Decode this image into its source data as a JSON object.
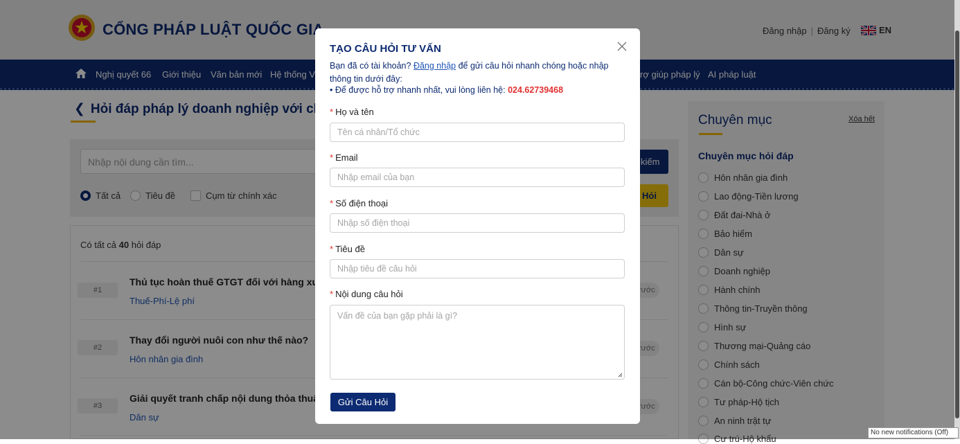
{
  "header": {
    "site_title": "CỔNG PHÁP LUẬT QUỐC GIA",
    "login": "Đăng nhập",
    "register": "Đăng ký",
    "lang": "EN"
  },
  "nav": {
    "items": [
      "Nghị quyết 66",
      "Giới thiệu",
      "Văn bản mới",
      "Hệ thống V",
      "rợ giúp pháp lý",
      "AI pháp luật"
    ]
  },
  "page": {
    "title": "Hỏi đáp pháp lý doanh nghiệp với chuy",
    "search_placeholder": "Nhập nội dung cần tìm...",
    "search_button": "kiếm",
    "ask_button": "Hỏi",
    "filters": [
      "Tất cả",
      "Tiêu đề",
      "Cụm từ chính xác"
    ],
    "count_prefix": "Có tất cả",
    "count_value": "40",
    "count_suffix": "hỏi đáp",
    "questions": [
      {
        "num": "#1",
        "title": "Thủ tục hoàn thuế GTGT đối với hàng xuấ",
        "category": "Thuế-Phí-Lệ phí",
        "badge": "rước"
      },
      {
        "num": "#2",
        "title": "Thay đổi người nuôi con như thế nào?",
        "category": "Hôn nhân gia đình",
        "badge": "rước"
      },
      {
        "num": "#3",
        "title": "Giải quyết tranh chấp nội dung thỏa thuậ",
        "category": "Dân sự",
        "badge": "rước"
      }
    ]
  },
  "sidebar": {
    "title": "Chuyên mục",
    "clear_all": "Xóa hết",
    "subtitle": "Chuyên mục hỏi đáp",
    "categories": [
      "Hôn nhân gia đình",
      "Lao động-Tiền lương",
      "Đất đai-Nhà ở",
      "Bảo hiểm",
      "Dân sự",
      "Doanh nghiệp",
      "Hành chính",
      "Thông tin-Truyền thông",
      "Hình sự",
      "Thương mại-Quảng cáo",
      "Chính sách",
      "Cán bộ-Công chức-Viên chức",
      "Tư pháp-Hộ tịch",
      "An ninh trật tự",
      "Cư trú-Hộ khẩu"
    ]
  },
  "modal": {
    "title": "TẠO CÂU HỎI TƯ VẤN",
    "intro_prefix": "Bạn đã có tài khoản?",
    "intro_link": "Đăng nhập",
    "intro_suffix": "để gửi câu hỏi nhanh chóng hoặc nhập thông tin dưới đây:",
    "hotline_text": "• Để được hỗ trợ nhanh nhất, vui lòng liên hệ:",
    "hotline_number": "024.62739468",
    "fields": {
      "name": {
        "label": "Họ và tên",
        "placeholder": "Tên cá nhân/Tổ chức"
      },
      "email": {
        "label": "Email",
        "placeholder": "Nhập email của bạn"
      },
      "phone": {
        "label": "Số điện thoại",
        "placeholder": "Nhập số điện thoại"
      },
      "subject": {
        "label": "Tiêu đề",
        "placeholder": "Nhập tiêu đề câu hỏi"
      },
      "content": {
        "label": "Nội dung câu hỏi",
        "placeholder": "Vấn đề của bạn gặp phải là gì?"
      }
    },
    "required_mark": "*",
    "submit": "Gửi Câu Hỏi"
  },
  "notification": "No new notifications (Off)",
  "colors": {
    "primary": "#0d2b72",
    "accent": "#f2b705",
    "danger": "#e03131",
    "link": "#1e55b3"
  }
}
